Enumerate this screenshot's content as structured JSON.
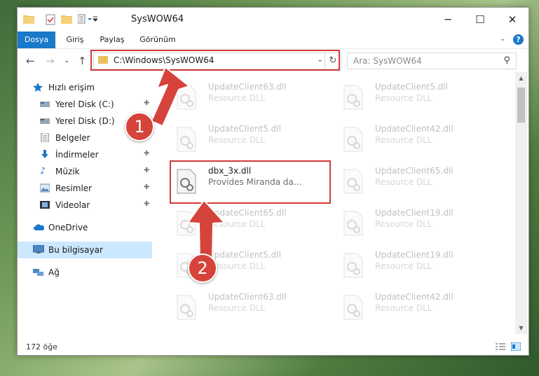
{
  "window": {
    "title": "SysWOW64",
    "controls": {
      "minimize": "─",
      "maximize": "☐",
      "close": "✕"
    }
  },
  "ribbon": {
    "tabs": [
      "Dosya",
      "Giriş",
      "Paylaş",
      "Görünüm"
    ],
    "help": "?"
  },
  "nav": {
    "address": "C:\\Windows\\SysWOW64",
    "search_placeholder": "Ara: SysWOW64"
  },
  "sidebar": {
    "items": [
      {
        "label": "Hızlı erişim",
        "icon": "star-icon",
        "pinned": false
      },
      {
        "label": "Yerel Disk (C:)",
        "icon": "drive-icon",
        "pinned": true
      },
      {
        "label": "Yerel Disk (D:)",
        "icon": "drive-icon",
        "pinned": false
      },
      {
        "label": "Belgeler",
        "icon": "document-icon",
        "pinned": true
      },
      {
        "label": "İndirmeler",
        "icon": "download-icon",
        "pinned": true
      },
      {
        "label": "Müzik",
        "icon": "music-icon",
        "pinned": true
      },
      {
        "label": "Resimler",
        "icon": "pictures-icon",
        "pinned": true
      },
      {
        "label": "Videolar",
        "icon": "video-icon",
        "pinned": true
      },
      {
        "label": "OneDrive",
        "icon": "cloud-icon",
        "pinned": false
      },
      {
        "label": "Bu bilgisayar",
        "icon": "computer-icon",
        "pinned": false
      },
      {
        "label": "Ağ",
        "icon": "network-icon",
        "pinned": false
      }
    ]
  },
  "files": {
    "left": [
      {
        "name": "UpdateClient63.dll",
        "desc": "Resource DLL"
      },
      {
        "name": "UpdateClient5.dll",
        "desc": "Resource DLL"
      },
      {
        "name": "dbx_3x.dll",
        "desc": "Provides Miranda da..."
      },
      {
        "name": "UpdateClient65.dll",
        "desc": "Resource DLL"
      },
      {
        "name": "UpdateClient5.dll",
        "desc": "Resource DLL"
      },
      {
        "name": "UpdateClient63.dll",
        "desc": "Resource DLL"
      }
    ],
    "right": [
      {
        "name": "UpdateClient5.dll",
        "desc": "Resource DLL"
      },
      {
        "name": "UpdateClient42.dll",
        "desc": "Resource DLL"
      },
      {
        "name": "UpdateClient65.dll",
        "desc": "Resource DLL"
      },
      {
        "name": "UpdateClient19.dll",
        "desc": "Resource DLL"
      },
      {
        "name": "UpdateClient19.dll",
        "desc": "Resource DLL"
      },
      {
        "name": "UpdateClient42.dll",
        "desc": "Resource DLL"
      }
    ],
    "highlighted_index": 2
  },
  "status": {
    "count": "172 öğe"
  },
  "annotations": {
    "callout_1": "1",
    "callout_2": "2",
    "color": "#d6433b"
  },
  "colors": {
    "accent": "#1979ca",
    "selected": "#cce8ff",
    "highlight_box": "#d23a3a"
  }
}
